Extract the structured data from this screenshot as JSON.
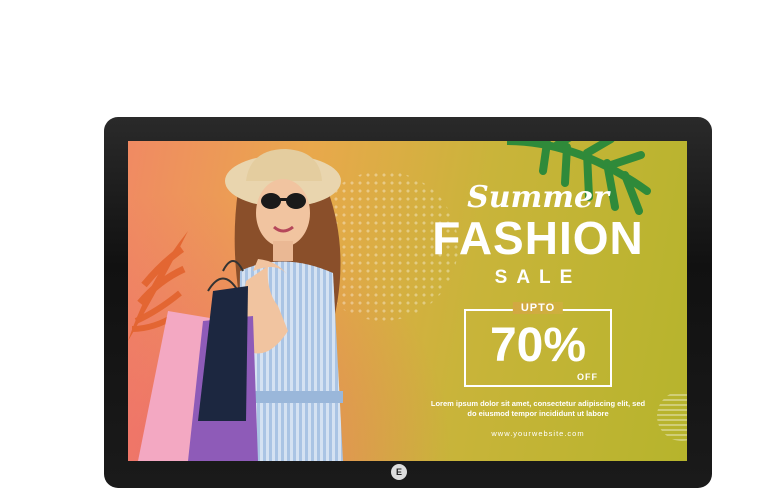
{
  "screen": {
    "headline_script": "Summer",
    "headline_main": "FASHION",
    "headline_sub": "SALE",
    "offer": {
      "prefix": "UPTO",
      "value": "70%",
      "suffix": "OFF"
    },
    "body_text_line1": "Lorem ipsum dolor sit amet, consectetur adipiscing elit, sed",
    "body_text_line2": "do eiusmod tempor incididunt ut labore",
    "website": "www.yourwebsite.com"
  },
  "monitor": {
    "logo_text": "E"
  },
  "colors": {
    "bezel": "#1a1a1a",
    "bg_left": "#f08a63",
    "bg_right": "#b6b42c",
    "text": "#ffffff"
  }
}
